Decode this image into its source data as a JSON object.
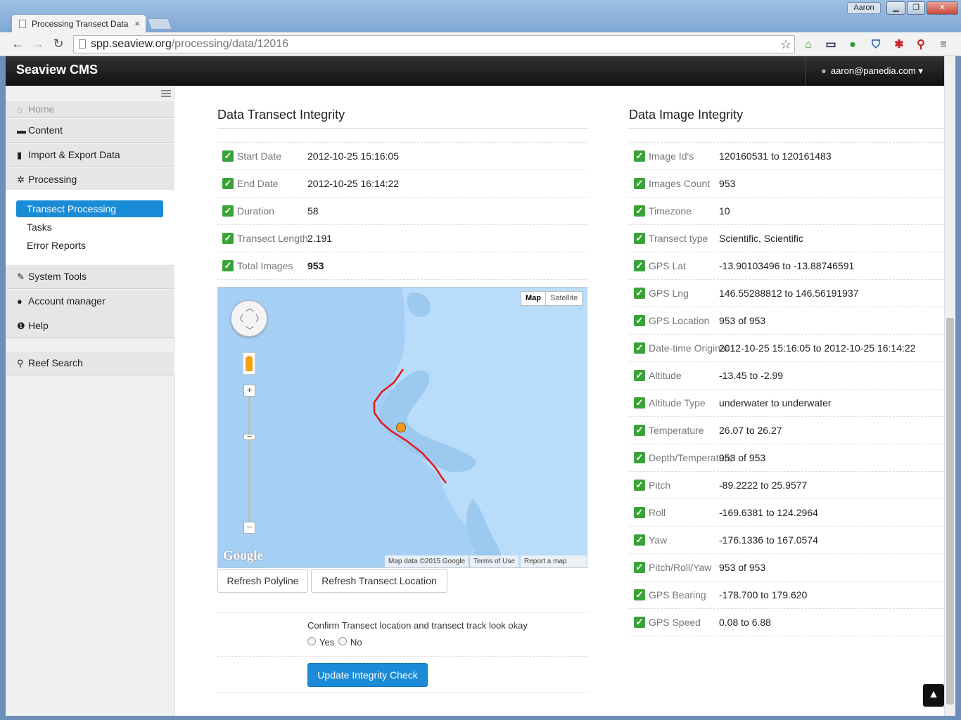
{
  "browser": {
    "tab_title": "Processing Transect Data",
    "tab_close": "×",
    "profile": "Aaron",
    "url_host": "spp.seaview.org",
    "url_path": "/processing/data/12016",
    "window_buttons": [
      "▁",
      "❐",
      "✕"
    ]
  },
  "app": {
    "brand": "Seaview CMS",
    "user_email": "aaron@panedia.com",
    "user_caret": "▾"
  },
  "sidebar": {
    "items": [
      {
        "label": "Home",
        "icon": "home-icon",
        "glyph": "⌂"
      },
      {
        "label": "Content",
        "icon": "folder-icon",
        "glyph": "▬"
      },
      {
        "label": "Import & Export Data",
        "icon": "file-icon",
        "glyph": "▮"
      },
      {
        "label": "Processing",
        "icon": "gear-icon",
        "glyph": "✲"
      },
      {
        "label": "System Tools",
        "icon": "wrench-icon",
        "glyph": "✎"
      },
      {
        "label": "Account manager",
        "icon": "user-icon",
        "glyph": "●"
      },
      {
        "label": "Help",
        "icon": "info-icon",
        "glyph": "❶"
      },
      {
        "label": "Reef Search",
        "icon": "search-icon",
        "glyph": "⚲"
      }
    ],
    "sub_items": [
      "Transect Processing",
      "Tasks",
      "Error Reports"
    ]
  },
  "transect": {
    "title": "Data Transect Integrity",
    "rows": [
      {
        "label": "Start Date",
        "value": "2012-10-25 15:16:05"
      },
      {
        "label": "End Date",
        "value": "2012-10-25 16:14:22"
      },
      {
        "label": "Duration",
        "value": "58"
      },
      {
        "label": "Transect Length",
        "value": "2.191"
      },
      {
        "label": "Total Images",
        "value": "953"
      }
    ]
  },
  "map": {
    "type_map": "Map",
    "type_satellite": "Satellite",
    "logo": "Google",
    "attrib_data": "Map data ©2015 Google",
    "attrib_terms": "Terms of Use",
    "attrib_report": "Report a map error",
    "zoom_in": "+",
    "zoom_out": "−",
    "track_color": "#e8141c",
    "marker_color": "#f39a1e"
  },
  "actions": {
    "refresh_polyline": "Refresh Polyline",
    "refresh_location": "Refresh Transect Location",
    "confirm_text": "Confirm Transect location and transect track look okay",
    "yes": "Yes",
    "no": "No",
    "update": "Update Integrity Check"
  },
  "image": {
    "title": "Data Image Integrity",
    "rows": [
      {
        "label": "Image Id's",
        "value": "120160531 to 120161483"
      },
      {
        "label": "Images Count",
        "value": "953"
      },
      {
        "label": "Timezone",
        "value": "10"
      },
      {
        "label": "Transect type",
        "value": "Scientific, Scientific"
      },
      {
        "label": "GPS Lat",
        "value": "-13.90103496 to -13.88746591"
      },
      {
        "label": "GPS Lng",
        "value": "146.55288812 to 146.56191937"
      },
      {
        "label": "GPS Location",
        "value": "953 of 953"
      },
      {
        "label": "Date-time Original",
        "value": "2012-10-25 15:16:05 to 2012-10-25 16:14:22"
      },
      {
        "label": "Altitude",
        "value": "-13.45 to -2.99"
      },
      {
        "label": "Altitude Type",
        "value": "underwater to underwater"
      },
      {
        "label": "Temperature",
        "value": "26.07 to 26.27"
      },
      {
        "label": "Depth/Temperature",
        "value": "953 of 953"
      },
      {
        "label": "Pitch",
        "value": "-89.2222 to 25.9577"
      },
      {
        "label": "Roll",
        "value": "-169.6381 to 124.2964"
      },
      {
        "label": "Yaw",
        "value": "-176.1336 to 167.0574"
      },
      {
        "label": "Pitch/Roll/Yaw",
        "value": "953 of 953"
      },
      {
        "label": "GPS Bearing",
        "value": "-178.700 to 179.620"
      },
      {
        "label": "GPS Speed",
        "value": "0.08 to 6.88"
      }
    ]
  },
  "misc": {
    "back_to_top": "▲",
    "check_glyph": "✓"
  }
}
